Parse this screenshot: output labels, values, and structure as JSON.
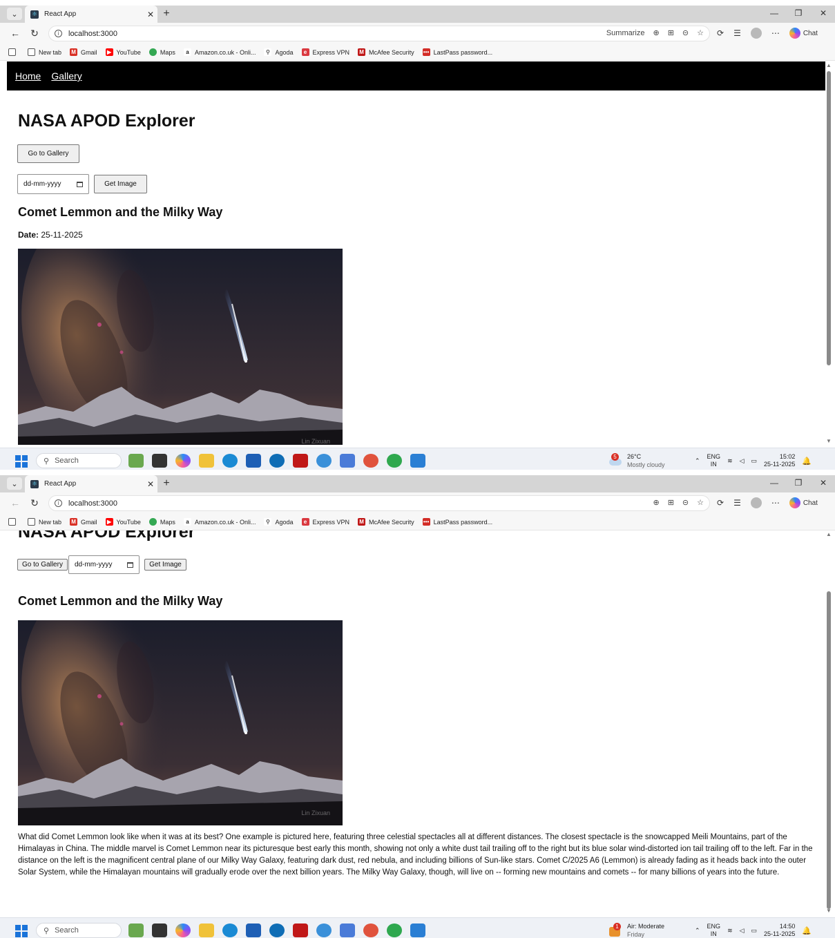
{
  "screens": [
    {
      "browser": {
        "tab_title": "React App",
        "url": "localhost:3000",
        "summarize_label": "Summarize",
        "chat_label": "Chat"
      },
      "taskbar": {
        "search_placeholder": "Search",
        "weather_badge": "5",
        "weather_temp": "26°C",
        "weather_desc": "Mostly cloudy",
        "lang_top": "ENG",
        "lang_bottom": "IN",
        "time": "15:02",
        "date": "25-11-2025"
      }
    },
    {
      "browser": {
        "tab_title": "React App",
        "url": "localhost:3000",
        "chat_label": "Chat"
      },
      "taskbar": {
        "search_placeholder": "Search",
        "weather_badge": "1",
        "weather_temp": "Air: Moderate",
        "weather_desc": "Friday",
        "lang_top": "ENG",
        "lang_bottom": "IN",
        "time": "14:50",
        "date": "25-11-2025"
      }
    }
  ],
  "bookmarks": [
    {
      "label": "New tab",
      "color": "#ffffff"
    },
    {
      "label": "Gmail",
      "color": "#d93025"
    },
    {
      "label": "YouTube",
      "color": "#ff0000"
    },
    {
      "label": "Maps",
      "color": "#34a853"
    },
    {
      "label": "Amazon.co.uk - Onli...",
      "color": "#222222"
    },
    {
      "label": "Agoda",
      "color": "#777777"
    },
    {
      "label": "Express VPN",
      "color": "#da3940"
    },
    {
      "label": "McAfee Security",
      "color": "#c01818"
    },
    {
      "label": "LastPass password...",
      "color": "#d32d27"
    }
  ],
  "app": {
    "nav_home": "Home",
    "nav_gallery": "Gallery",
    "heading": "NASA APOD Explorer",
    "go_gallery_label": "Go to Gallery",
    "date_placeholder": "dd-mm-yyyy",
    "get_image_label": "Get Image",
    "apod_title": "Comet Lemmon and the Milky Way",
    "date_label": "Date:",
    "date_value": "25-11-2025",
    "image_credit": "Lin Zixuan",
    "explanation": "What did Comet Lemmon look like when it was at its best? One example is pictured here, featuring three celestial spectacles all at different distances. The closest spectacle is the snowcapped Meili Mountains, part of the Himalayas in China. The middle marvel is Comet Lemmon near its picturesque best early this month, showing not only a white dust tail trailing off to the right but its blue solar wind-distorted ion tail trailing off to the left. Far in the distance on the left is the magnificent central plane of our Milky Way Galaxy, featuring dark dust, red nebula, and including billions of Sun-like stars. Comet C/2025 A6 (Lemmon) is already fading as it heads back into the outer Solar System, while the Himalayan mountains will gradually erode over the next billion years. The Milky Way Galaxy, though, will live on -- forming new mountains and comets -- for many billions of years into the future."
  },
  "colors": {
    "navbar_bg": "#000000",
    "taskbar_bg": "#eef1f6",
    "windows_blue": "#1a73d9"
  }
}
